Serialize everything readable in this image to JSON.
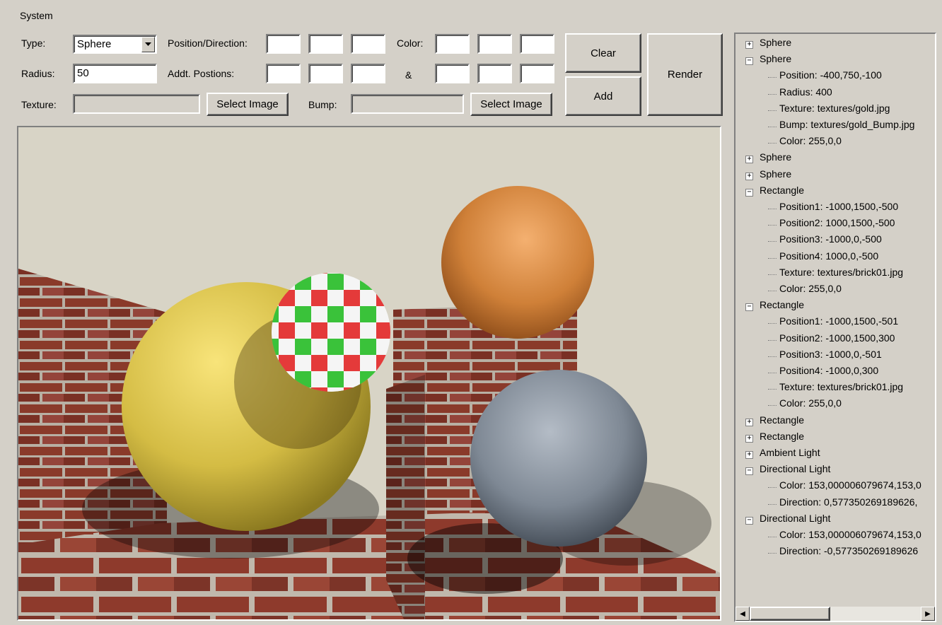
{
  "menu": {
    "system": "System"
  },
  "form": {
    "type_label": "Type:",
    "type_value": "Sphere",
    "radius_label": "Radius:",
    "radius_value": "50",
    "texture_label": "Texture:",
    "select_image_1": "Select Image",
    "position_label": "Position/Direction:",
    "addt_label": "Addt. Postions:",
    "bump_label": "Bump:",
    "select_image_2": "Select Image",
    "color_label": "Color:",
    "amp_label": "&"
  },
  "buttons": {
    "clear": "Clear",
    "add": "Add",
    "render": "Render"
  },
  "tree": {
    "items": [
      "Sphere",
      "Sphere",
      "Position: -400,750,-100",
      "Radius: 400",
      "Texture: textures/gold.jpg",
      "Bump: textures/gold_Bump.jpg",
      "Color: 255,0,0",
      "Sphere",
      "Sphere",
      "Rectangle",
      "Position1: -1000,1500,-500",
      "Position2: 1000,1500,-500",
      "Position3: -1000,0,-500",
      "Position4: 1000,0,-500",
      "Texture: textures/brick01.jpg",
      "Color: 255,0,0",
      "Rectangle",
      "Position1: -1000,1500,-501",
      "Position2: -1000,1500,300",
      "Position3: -1000,0,-501",
      "Position4: -1000,0,300",
      "Texture: textures/brick01.jpg",
      "Color: 255,0,0",
      "Rectangle",
      "Rectangle",
      "Ambient Light",
      "Directional Light",
      "Color: 153,000006079674,153,0",
      "Direction: 0,577350269189626,",
      "Directional Light",
      "Color: 153,000006079674,153,0",
      "Direction: -0,577350269189626"
    ]
  },
  "icons": {
    "dropdown": "chevron-down-icon",
    "expand": "plus-icon",
    "collapse": "minus-icon",
    "scroll_left": "arrow-left-icon",
    "scroll_right": "arrow-right-icon"
  },
  "colors": {
    "window_bg": "#d4d0c8",
    "gold_sphere": "#d8c048",
    "copper_sphere": "#d0803a",
    "steel_sphere": "#8a96a2",
    "brick": "#8a3a2a"
  }
}
